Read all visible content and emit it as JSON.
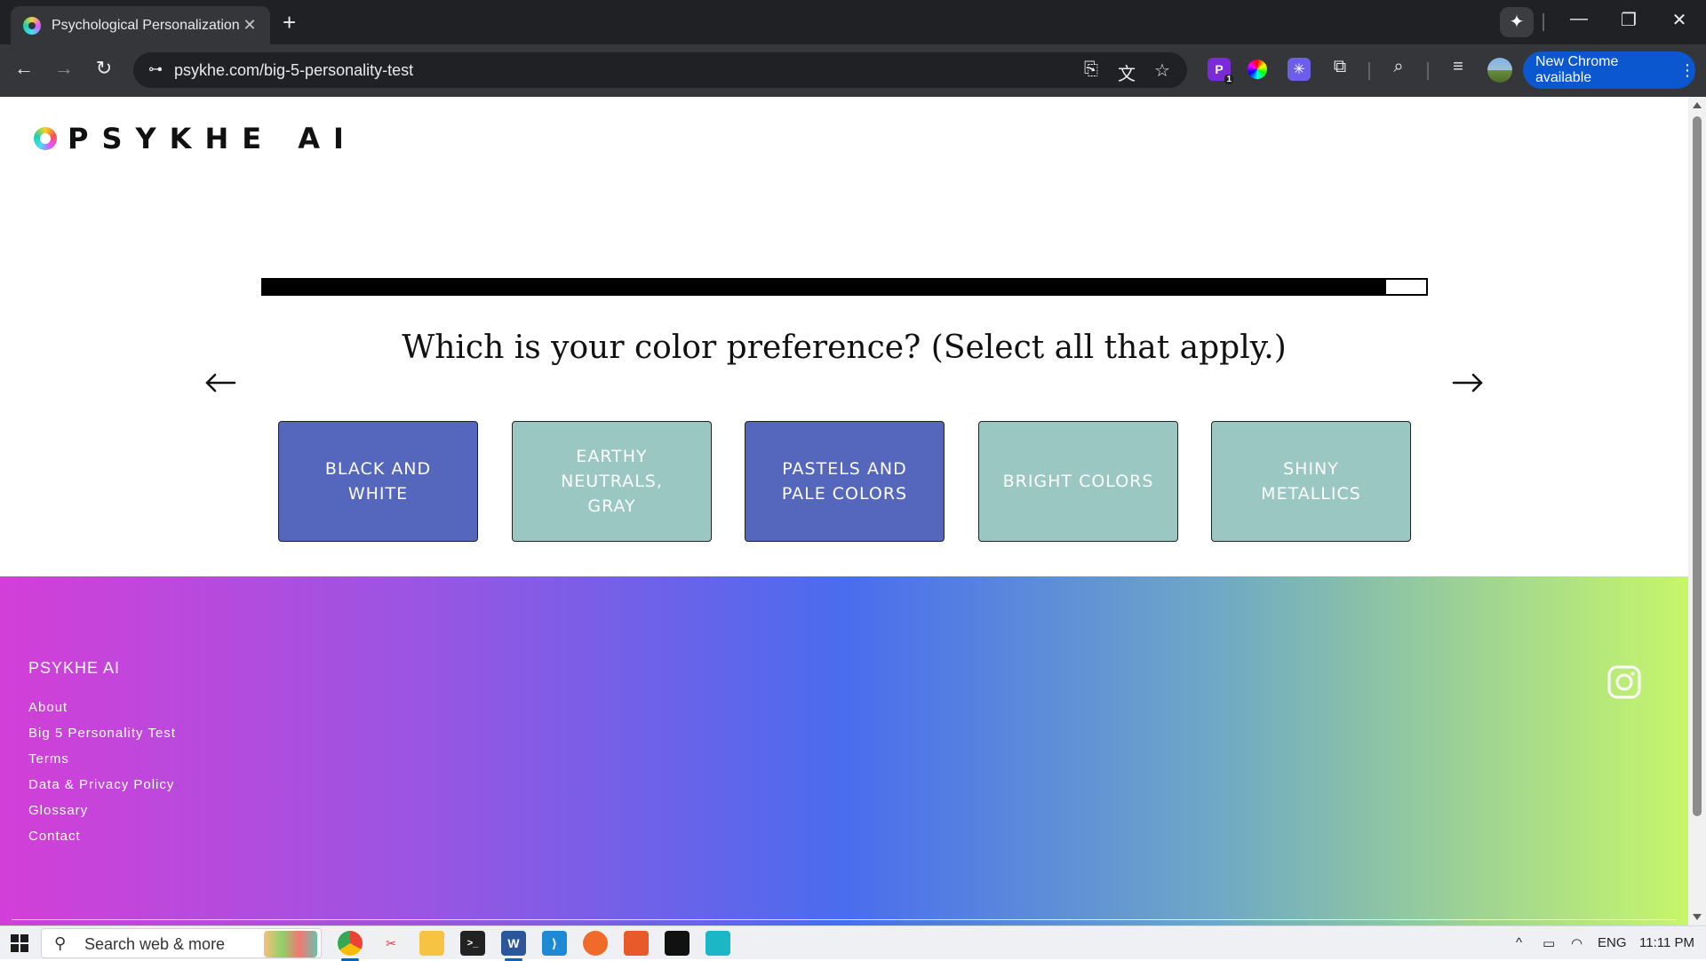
{
  "browser": {
    "tab_title": "Psychological Personalization | I",
    "tab_close": "✕",
    "new_tab": "+",
    "gemini": "✦",
    "url": "psykhe.com/big-5-personality-test",
    "update_label": "New Chrome available",
    "menu_dots": "⋮",
    "window_minimize": "—",
    "window_restore": "❐",
    "window_close": "✕",
    "extension_badge": "1",
    "icons": {
      "back": "←",
      "forward": "→",
      "reload": "↻",
      "site_info": "⊶",
      "install": "⎘",
      "translate": "文",
      "bookmark": "☆",
      "extensions": "⧉",
      "tab_search": "⌕",
      "media": "≡"
    }
  },
  "page": {
    "logo_text": "PSYKHE AI",
    "progress_fraction": 0.966,
    "question": "Which is your color preference? (Select all that apply.)",
    "arrow_prev": "←",
    "arrow_next": "→",
    "options": [
      {
        "label": "BLACK AND WHITE",
        "selected": true
      },
      {
        "label": "EARTHY NEUTRALS, GRAY",
        "selected": false
      },
      {
        "label": "PASTELS AND PALE COLORS",
        "selected": true
      },
      {
        "label": "BRIGHT COLORS",
        "selected": false
      },
      {
        "label": "SHINY METALLICS",
        "selected": false
      }
    ],
    "colors": {
      "selected_option": "#5467bd",
      "unselected_option": "#9bc7c2"
    }
  },
  "footer": {
    "brand": "PSYKHE AI",
    "links": [
      "About",
      "Big 5 Personality Test",
      "Terms",
      "Data & Privacy Policy",
      "Glossary",
      "Contact"
    ],
    "social_icon": "instagram-icon"
  },
  "taskbar": {
    "search_placeholder": "Search web & more",
    "search_glyph": "⚲",
    "language": "ENG",
    "time": "11:11 PM",
    "tray_chevron": "^",
    "tray_wifi": "◠",
    "tray_monitor": "▭"
  }
}
